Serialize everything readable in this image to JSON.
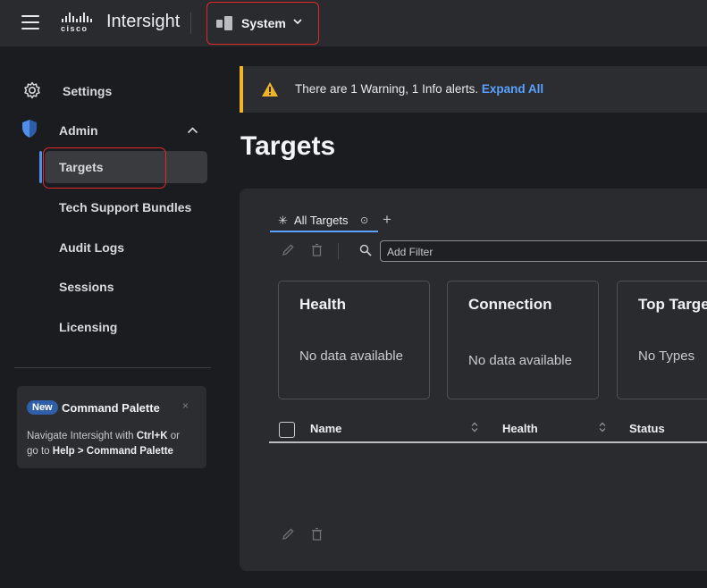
{
  "topbar": {
    "brand": "Intersight",
    "logo_word": "cisco",
    "scope_label": "System"
  },
  "sidebar": {
    "settings_label": "Settings",
    "admin_label": "Admin",
    "sub_items": [
      {
        "label": "Targets",
        "active": true
      },
      {
        "label": "Tech Support Bundles"
      },
      {
        "label": "Audit Logs"
      },
      {
        "label": "Sessions"
      },
      {
        "label": "Licensing"
      }
    ],
    "command_card": {
      "badge": "New",
      "title": "Command Palette",
      "close": "×",
      "line1_a": "Navigate Intersight with ",
      "line1_key": "Ctrl+K",
      "line1_b": " or",
      "line2_a": "go to ",
      "line2_path": "Help > Command Palette"
    }
  },
  "alert": {
    "message": "There are 1 Warning, 1 Info alerts. ",
    "action": "Expand All",
    "color": "#f0b429"
  },
  "main": {
    "title": "Targets",
    "tab_label": "All Targets",
    "filter_placeholder": "Add Filter",
    "cards": [
      {
        "title": "Health",
        "body": "No data available"
      },
      {
        "title": "Connection",
        "body": "No data available"
      },
      {
        "title": "Top Targe",
        "body": "No Types"
      }
    ],
    "columns": [
      "Name",
      "Health",
      "Status"
    ]
  },
  "colors": {
    "accent": "#5aa1ff",
    "highlight_box": "#e02a2a"
  }
}
